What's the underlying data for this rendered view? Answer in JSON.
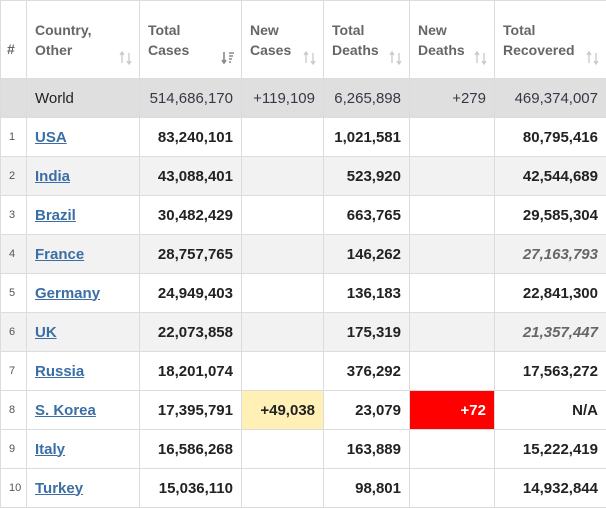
{
  "colors": {
    "header_text": "#666666",
    "link": "#3b6ea5",
    "world_row_bg": "#dfdfdf",
    "alt_row_bg": "#f2f2f2",
    "new_cases_highlight": "#fff1b6",
    "new_deaths_highlight": "#ff0000"
  },
  "headers": {
    "num": "#",
    "country_1": "Country,",
    "country_2": "Other",
    "total_cases_1": "Total",
    "total_cases_2": "Cases",
    "new_cases_1": "New",
    "new_cases_2": "Cases",
    "total_deaths_1": "Total",
    "total_deaths_2": "Deaths",
    "new_deaths_1": "New",
    "new_deaths_2": "Deaths",
    "total_recovered_1": "Total",
    "total_recovered_2": "Recovered"
  },
  "world": {
    "country": "World",
    "total_cases": "514,686,170",
    "new_cases": "+119,109",
    "total_deaths": "6,265,898",
    "new_deaths": "+279",
    "total_recovered": "469,374,007"
  },
  "rows": [
    {
      "idx": "1",
      "country": "USA",
      "total_cases": "83,240,101",
      "new_cases": "",
      "total_deaths": "1,021,581",
      "new_deaths": "",
      "total_recovered": "80,795,416"
    },
    {
      "idx": "2",
      "country": "India",
      "total_cases": "43,088,401",
      "new_cases": "",
      "total_deaths": "523,920",
      "new_deaths": "",
      "total_recovered": "42,544,689"
    },
    {
      "idx": "3",
      "country": "Brazil",
      "total_cases": "30,482,429",
      "new_cases": "",
      "total_deaths": "663,765",
      "new_deaths": "",
      "total_recovered": "29,585,304"
    },
    {
      "idx": "4",
      "country": "France",
      "total_cases": "28,757,765",
      "new_cases": "",
      "total_deaths": "146,262",
      "new_deaths": "",
      "total_recovered": "27,163,793"
    },
    {
      "idx": "5",
      "country": "Germany",
      "total_cases": "24,949,403",
      "new_cases": "",
      "total_deaths": "136,183",
      "new_deaths": "",
      "total_recovered": "22,841,300"
    },
    {
      "idx": "6",
      "country": "UK",
      "total_cases": "22,073,858",
      "new_cases": "",
      "total_deaths": "175,319",
      "new_deaths": "",
      "total_recovered": "21,357,447"
    },
    {
      "idx": "7",
      "country": "Russia",
      "total_cases": "18,201,074",
      "new_cases": "",
      "total_deaths": "376,292",
      "new_deaths": "",
      "total_recovered": "17,563,272"
    },
    {
      "idx": "8",
      "country": "S. Korea",
      "total_cases": "17,395,791",
      "new_cases": "+49,038",
      "total_deaths": "23,079",
      "new_deaths": "+72",
      "total_recovered": "N/A"
    },
    {
      "idx": "9",
      "country": "Italy",
      "total_cases": "16,586,268",
      "new_cases": "",
      "total_deaths": "163,889",
      "new_deaths": "",
      "total_recovered": "15,222,419"
    },
    {
      "idx": "10",
      "country": "Turkey",
      "total_cases": "15,036,110",
      "new_cases": "",
      "total_deaths": "98,801",
      "new_deaths": "",
      "total_recovered": "14,932,844"
    }
  ]
}
